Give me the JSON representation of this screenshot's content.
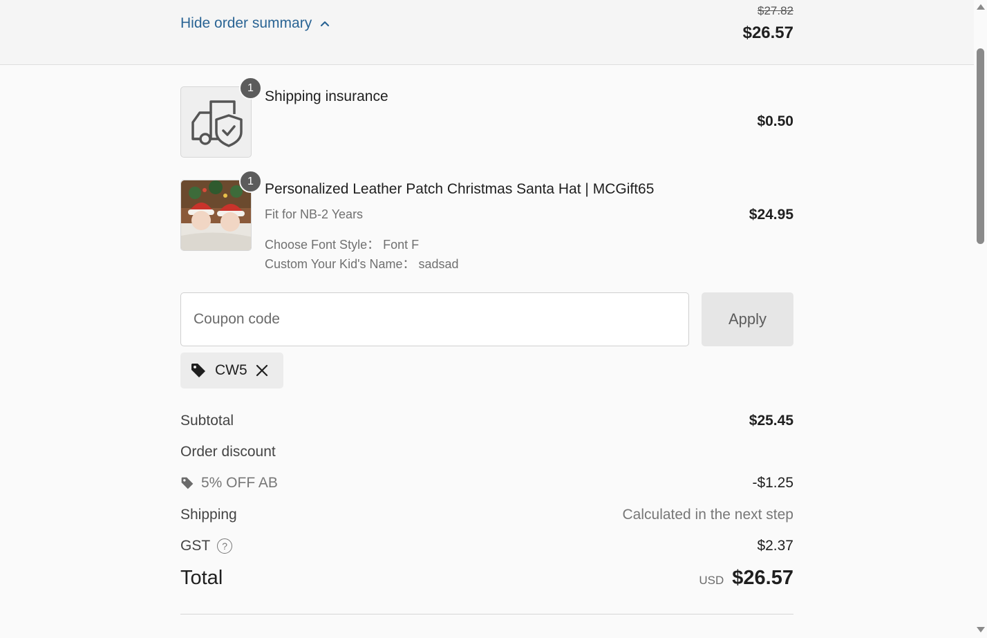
{
  "header": {
    "toggle_label": "Hide order summary",
    "original_price": "$27.82",
    "total_price": "$26.57"
  },
  "items": [
    {
      "title": "Shipping insurance",
      "quantity": "1",
      "price": "$0.50",
      "icon": "truck-shield-icon"
    },
    {
      "title": "Personalized Leather Patch Christmas Santa Hat | MCGift65",
      "quantity": "1",
      "price": "$24.95",
      "variant": "Fit for NB-2 Years",
      "option_1": "Choose Font Style： Font F",
      "option_2": "Custom Your Kid's Name： sadsad"
    }
  ],
  "coupon": {
    "placeholder": "Coupon code",
    "apply_label": "Apply",
    "applied_code": "CW5"
  },
  "summary": {
    "subtotal_label": "Subtotal",
    "subtotal_value": "$25.45",
    "order_discount_label": "Order discount",
    "discount_name": "5% OFF AB",
    "discount_value": "-$1.25",
    "shipping_label": "Shipping",
    "shipping_value": "Calculated in the next step",
    "gst_label": "GST",
    "gst_value": "$2.37",
    "total_label": "Total",
    "currency": "USD",
    "total_value": "$26.57"
  },
  "colors": {
    "link": "#2a6494",
    "badge": "#5c5c5c",
    "apply_bg": "#e6e6e6"
  }
}
